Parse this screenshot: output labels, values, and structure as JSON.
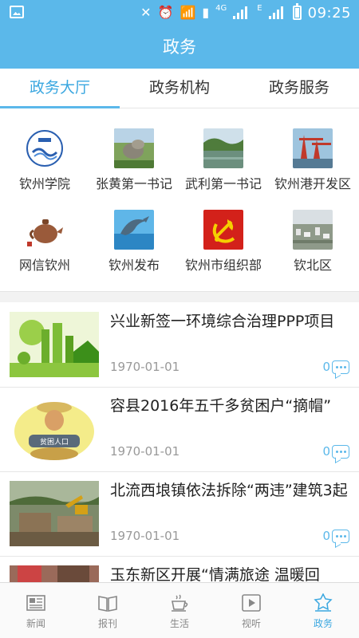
{
  "status_bar": {
    "network": "4G",
    "network2": "E",
    "time": "09:25"
  },
  "header": {
    "title": "政务"
  },
  "tabs": [
    {
      "label": "政务大厅",
      "active": true
    },
    {
      "label": "政务机构",
      "active": false
    },
    {
      "label": "政务服务",
      "active": false
    }
  ],
  "grid": [
    {
      "label": "钦州学院",
      "icon": "university-logo-icon"
    },
    {
      "label": "张黄第一书记",
      "icon": "rock-landscape-photo"
    },
    {
      "label": "武利第一书记",
      "icon": "river-landscape-photo"
    },
    {
      "label": "钦州港开发区",
      "icon": "port-crane-photo"
    },
    {
      "label": "网信钦州",
      "icon": "teapot-photo"
    },
    {
      "label": "钦州发布",
      "icon": "dolphin-photo"
    },
    {
      "label": "钦州市组织部",
      "icon": "party-emblem-icon"
    },
    {
      "label": "钦北区",
      "icon": "city-aerial-photo"
    }
  ],
  "news": [
    {
      "headline": "兴业新签一环境综合治理PPP项目",
      "date": "1970-01-01",
      "comments": "0"
    },
    {
      "headline": "容县2016年五千多贫困户“摘帽”",
      "date": "1970-01-01",
      "comments": "0"
    },
    {
      "headline": "北流西埌镇依法拆除“两违”建筑3起",
      "date": "1970-01-01",
      "comments": "0"
    },
    {
      "headline": "玉东新区开展“情满旅途 温暖回",
      "date": "",
      "comments": ""
    }
  ],
  "thumb_texts": {
    "poverty_sign": "贫困人口"
  },
  "bottom_nav": [
    {
      "label": "新闻",
      "active": false
    },
    {
      "label": "报刊",
      "active": false
    },
    {
      "label": "生活",
      "active": false
    },
    {
      "label": "视听",
      "active": false
    },
    {
      "label": "政务",
      "active": true
    }
  ],
  "colors": {
    "accent": "#5bb8ea",
    "active_text": "#3aa7e0",
    "date_gray": "#999999"
  }
}
